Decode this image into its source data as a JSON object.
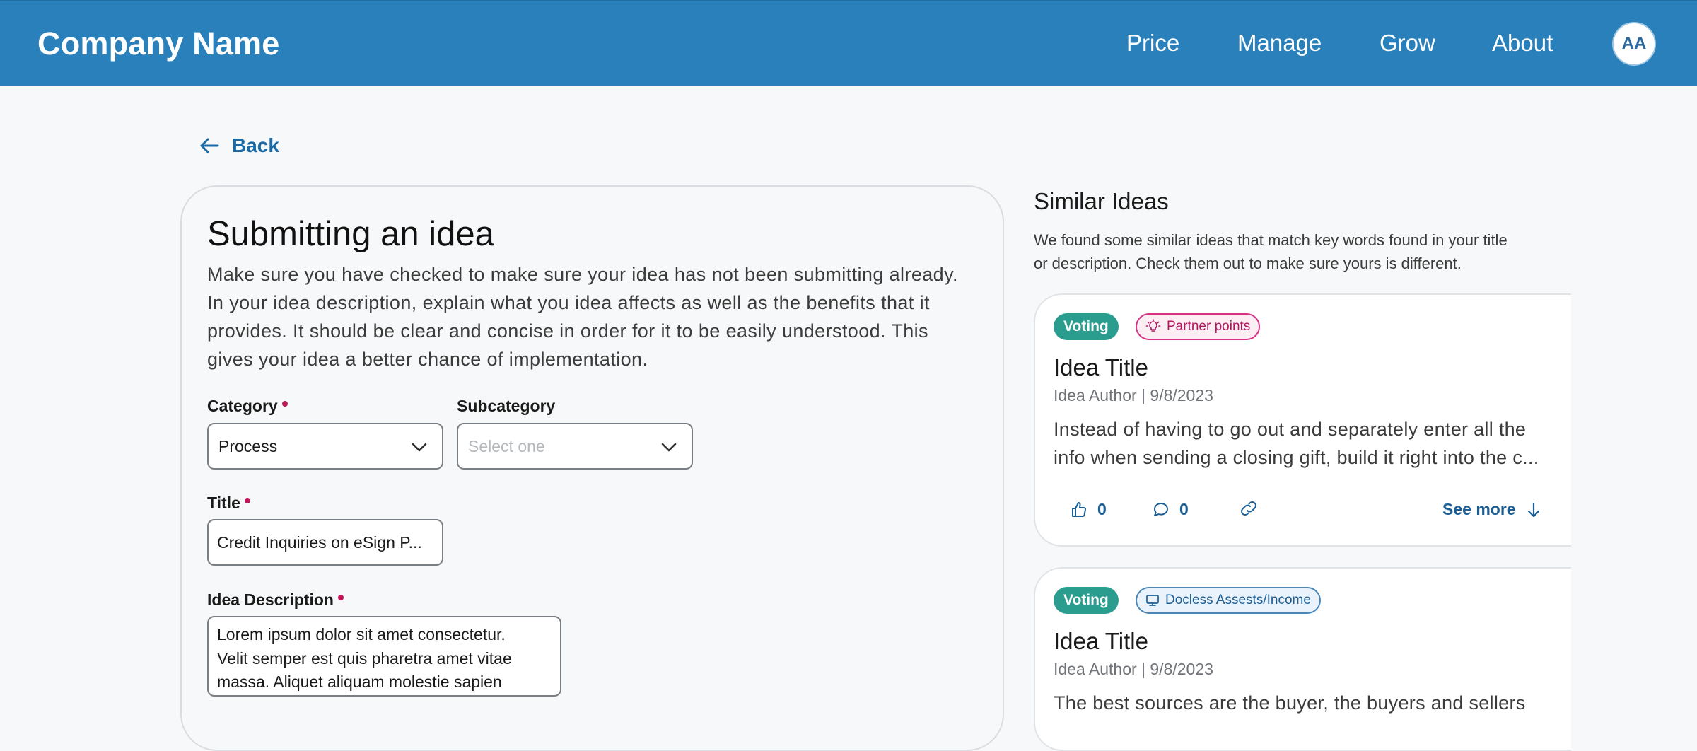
{
  "header": {
    "brand": "Company Name",
    "nav": [
      "Price",
      "Manage",
      "Grow",
      "About"
    ],
    "avatar_initials": "AA",
    "bg_color": "#2980bb"
  },
  "back_label": "Back",
  "form": {
    "title": "Submitting an idea",
    "description_lines": [
      "Make sure you have checked to make sure your idea has not been submitting already.",
      "In your idea description, explain what you idea affects as well as the benefits that it",
      "provides. It should be clear and concise in order for it to be easily understood. This",
      "gives your idea a better chance of implementation."
    ],
    "category": {
      "label": "Category",
      "value": "Process",
      "required": true
    },
    "subcategory": {
      "label": "Subcategory",
      "placeholder": "Select one"
    },
    "title_field": {
      "label": "Title",
      "value": "Credit Inquiries on eSign P...",
      "required": true
    },
    "idea_description": {
      "label": "Idea Description",
      "required": true,
      "lines": [
        "Lorem ipsum dolor sit amet consectetur.",
        "Velit semper est quis pharetra amet vitae",
        "massa. Aliquet aliquam molestie sapien"
      ]
    }
  },
  "similar": {
    "title": "Similar Ideas",
    "description_lines": [
      "We found some similar ideas that match key words found in your title",
      "or description. Check them out to make sure yours is different."
    ],
    "ideas": [
      {
        "status": "Voting",
        "tag": "Partner points",
        "tag_icon": "lightbulb-icon",
        "title": "Idea Title",
        "meta": "Idea Author | 9/8/2023",
        "body_lines": [
          "Instead of having to go out and separately enter all the",
          "info when sending a closing gift, build it right into the c..."
        ],
        "likes": "0",
        "comments": "0",
        "see_more": "See more"
      },
      {
        "status": "Voting",
        "tag": "Docless Assests/Income",
        "tag_icon": "monitor-icon",
        "title": "Idea Title",
        "meta": "Idea Author | 9/8/2023",
        "body_lines": [
          "The best sources are the buyer, the buyers and sellers"
        ]
      }
    ]
  },
  "colors": {
    "accent": "#1c6aa5",
    "voting_badge": "#2a9d8f",
    "required_dot": "#c2185b",
    "tag_pink": "#d63384"
  }
}
